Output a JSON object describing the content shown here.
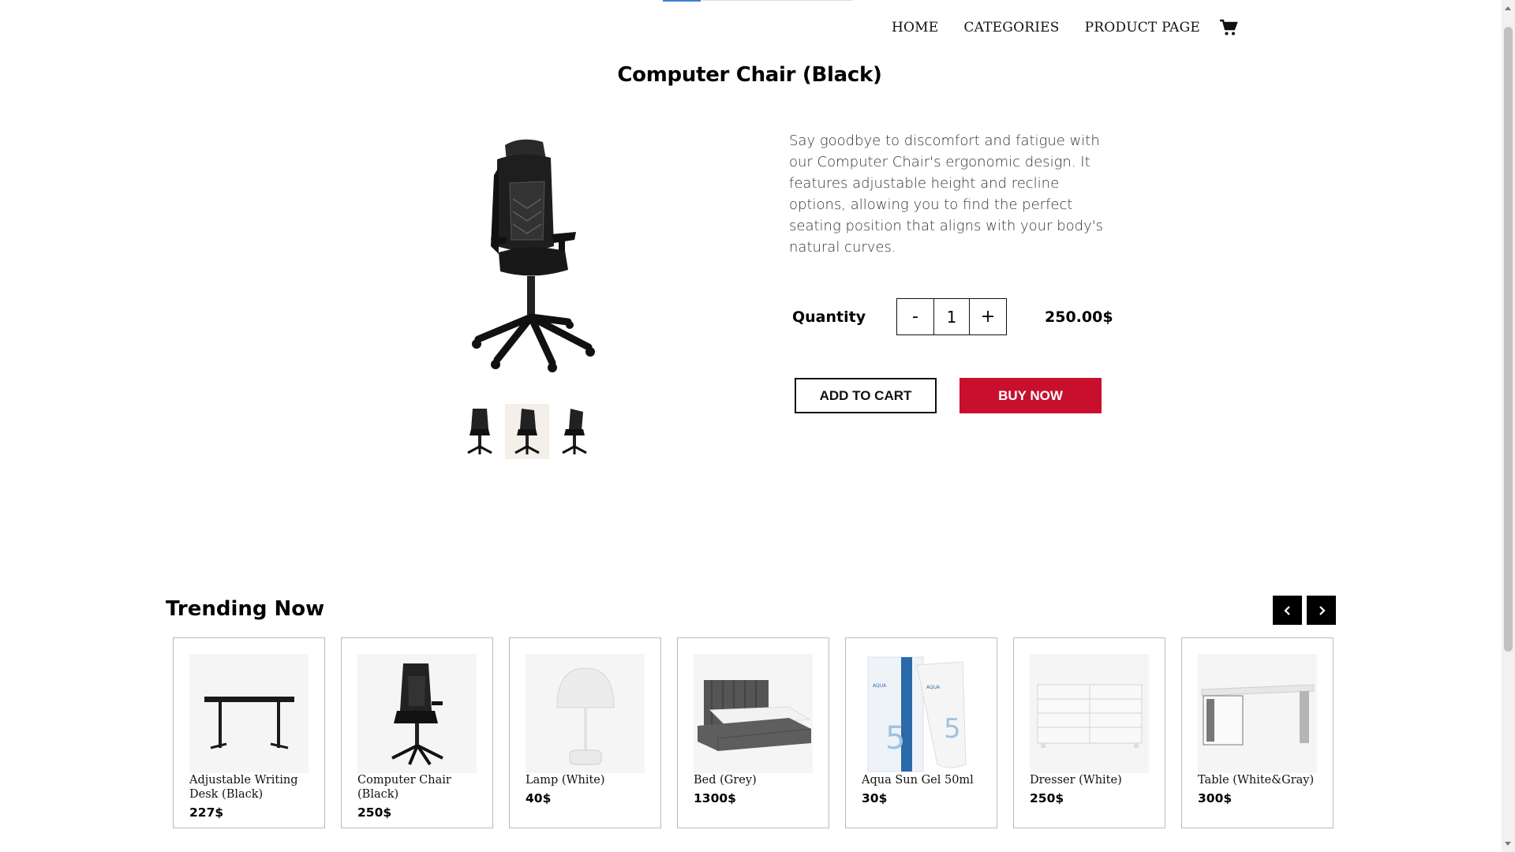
{
  "nav": {
    "items": [
      "HOME",
      "CATEGORIES",
      "PRODUCT PAGE"
    ],
    "cart_icon": "shopping-cart-icon"
  },
  "product": {
    "title": "Computer Chair (Black)",
    "description": "Say goodbye to discomfort and fatigue with our Computer Chair's ergonomic design. It features adjustable height and recline options, allowing you to find the perfect seating position that aligns with your body's natural curves.",
    "quantity_label": "Quantity",
    "quantity": "1",
    "minus": "-",
    "plus": "+",
    "price": "250.00$",
    "add_to_cart": "ADD TO CART",
    "buy_now": "BUY NOW",
    "accent_color": "#c8102e"
  },
  "trending": {
    "title": "Trending Now",
    "items": [
      {
        "name": "Adjustable Writing Desk (Black)",
        "price": "227$"
      },
      {
        "name": "Computer Chair (Black)",
        "price": "250$"
      },
      {
        "name": "Lamp (White)",
        "price": "40$"
      },
      {
        "name": "Bed (Grey)",
        "price": "1300$"
      },
      {
        "name": "Aqua Sun Gel 50ml",
        "price": "30$"
      },
      {
        "name": "Dresser (White)",
        "price": "250$"
      },
      {
        "name": "Table (White&Gray)",
        "price": "300$"
      }
    ]
  }
}
